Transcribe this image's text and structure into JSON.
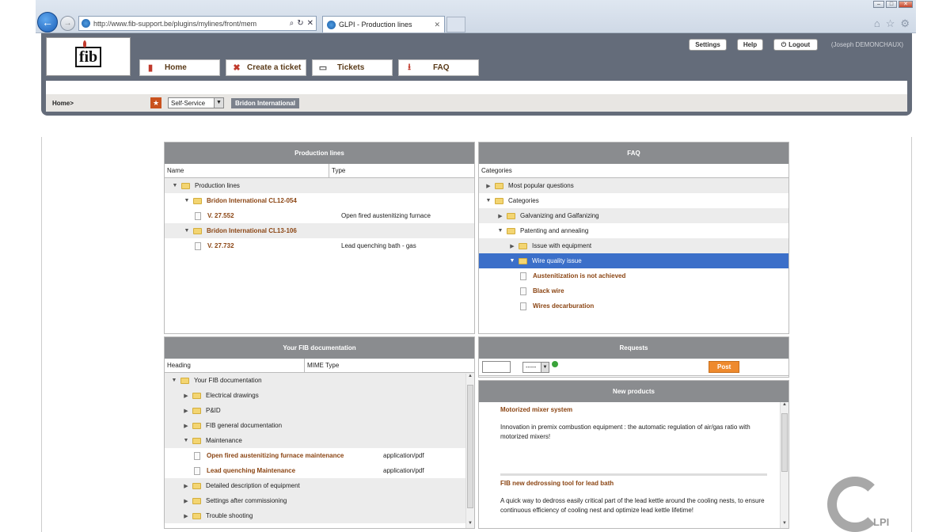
{
  "browser": {
    "url": "http://www.fib-support.be/plugins/mylines/front/mem",
    "tab_title": "GLPI - Production lines"
  },
  "header": {
    "logo_text": "fib",
    "menu": {
      "home": "Home",
      "create_ticket": "Create a ticket",
      "tickets": "Tickets",
      "faq": "FAQ"
    },
    "settings": "Settings",
    "help": "Help",
    "logout": "Logout",
    "user": "(Joseph DEMONCHAUX)"
  },
  "breadcrumb": {
    "home": "Home>",
    "profile": "Self-Service",
    "entity": "Bridon International"
  },
  "production_lines": {
    "title": "Production lines",
    "col_name": "Name",
    "col_type": "Type",
    "root": "Production lines",
    "lines": [
      {
        "name": "Bridon International CL12-054",
        "item": "V. 27.552",
        "type": "Open fired austenitizing furnace"
      },
      {
        "name": "Bridon International CL13-106",
        "item": "V. 27.732",
        "type": "Lead quenching bath - gas"
      }
    ]
  },
  "faq": {
    "title": "FAQ",
    "col": "Categories",
    "popular": "Most popular questions",
    "categories": "Categories",
    "galvanizing": "Galvanizing and Galfanizing",
    "patenting": "Patenting and annealing",
    "issue_equipment": "Issue with equipment",
    "wire_quality": "Wire quality issue",
    "articles": [
      "Austenitization is not achieved",
      "Black wire",
      "Wires decarburation"
    ]
  },
  "docs": {
    "title": "Your FIB documentation",
    "col_heading": "Heading",
    "col_mime": "MIME Type",
    "root": "Your FIB documentation",
    "folders_top": [
      "Electrical drawings",
      "P&ID",
      "FIB general documentation"
    ],
    "maintenance": "Maintenance",
    "files": [
      {
        "name": "Open fired austenitizing furnace maintenance",
        "mime": "application/pdf"
      },
      {
        "name": "Lead quenching Maintenance",
        "mime": "application/pdf"
      }
    ],
    "folders_bottom": [
      "Detailed description of equipment",
      "Settings after commissioning",
      "Trouble shooting"
    ]
  },
  "requests": {
    "title": "Requests",
    "select_value": "-----",
    "post": "Post"
  },
  "new_products": {
    "title": "New products",
    "items": [
      {
        "heading": "Motorized mixer system",
        "text": "Innovation in premix combustion equipment : the automatic regulation of air/gas ratio with motorized mixers!"
      },
      {
        "heading": "FIB new dedrossing tool for lead bath",
        "text": "A quick way to dedross easily critical part of the lead kettle around the cooling nests, to ensure continuous efficiency of cooling nest and optimize lead kettle lifetime!"
      }
    ]
  },
  "footer_logo": "LPI"
}
